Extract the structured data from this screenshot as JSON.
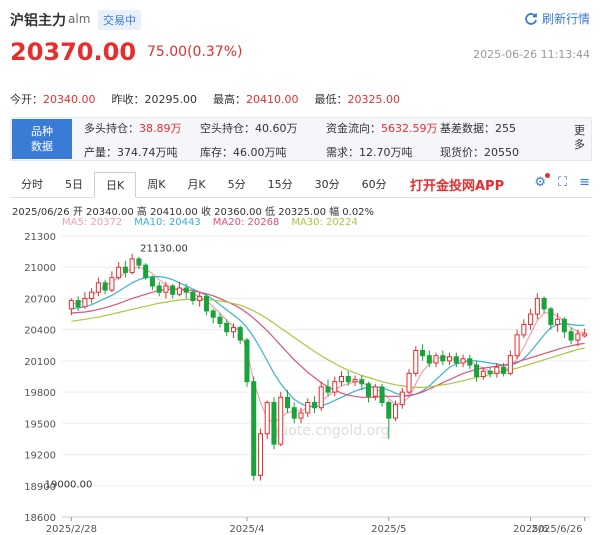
{
  "header": {
    "name": "沪铝主力",
    "code": "alm",
    "status": "交易中",
    "refresh_label": "刷新行情",
    "price": "20370.00",
    "change": "75.00(0.37%)",
    "datetime": "2025-06-26 11:13:44"
  },
  "quote": [
    {
      "label": "今开：",
      "value": "20340.00",
      "color": "red"
    },
    {
      "label": "昨收：",
      "value": "20295.00",
      "color": "black"
    },
    {
      "label": "最高：",
      "value": "20410.00",
      "color": "red"
    },
    {
      "label": "最低：",
      "value": "20325.00",
      "color": "red"
    }
  ],
  "info": {
    "tag_line1": "品种",
    "tag_line2": "数据",
    "more": "更多",
    "items": [
      {
        "label": "多头持仓：",
        "value": "38.89万",
        "color": "red"
      },
      {
        "label": "空头持仓：",
        "value": "40.60万",
        "color": "black"
      },
      {
        "label": "资金流向：",
        "value": "5632.59万",
        "color": "red"
      },
      {
        "label": "基差数据：",
        "value": "255",
        "color": "black"
      },
      {
        "label": "产量：",
        "value": "374.74万吨",
        "color": "black"
      },
      {
        "label": "库存：",
        "value": "46.00万吨",
        "color": "black"
      },
      {
        "label": "需求：",
        "value": "12.70万吨",
        "color": "black"
      },
      {
        "label": "现货价：",
        "value": "20550",
        "color": "black"
      }
    ]
  },
  "tabs": [
    "分时",
    "5日",
    "日K",
    "周K",
    "月K",
    "5分",
    "15分",
    "30分",
    "60分"
  ],
  "active_tab": "日K",
  "app_link": "打开金投网APP",
  "ohlc_line": "2025/06/26  开 20340.00  高 20410.00  收 20360.00  低 20325.00  幅 0.02%",
  "ma": [
    {
      "label": "MA5: 20372",
      "color": "#f2a0b0"
    },
    {
      "label": "MA10: 20443",
      "color": "#3ab0d8"
    },
    {
      "label": "MA20: 20268",
      "color": "#e0507a"
    },
    {
      "label": "MA30: 20224",
      "color": "#a8c840"
    }
  ],
  "watermark": "quote.cngold.org",
  "chart_data": {
    "type": "candlestick",
    "y_ticks": [
      21300,
      21000,
      20700,
      20400,
      20100,
      19800,
      19500,
      19200,
      18900,
      18600
    ],
    "ylim": [
      18600,
      21300
    ],
    "x_ticks": [
      "2025/2/28",
      "2025/4",
      "2025/5",
      "2025/6",
      "2025/6/26"
    ],
    "annotations": [
      {
        "label": "21130.00",
        "value": 21130
      },
      {
        "label": "19000.00",
        "value": 19000
      }
    ],
    "candles": [
      [
        20600,
        20680,
        20540,
        20700
      ],
      [
        20680,
        20620,
        20580,
        20720
      ],
      [
        20620,
        20700,
        20600,
        20760
      ],
      [
        20700,
        20760,
        20650,
        20800
      ],
      [
        20760,
        20850,
        20720,
        20900
      ],
      [
        20850,
        20780,
        20740,
        20880
      ],
      [
        20780,
        20900,
        20760,
        20960
      ],
      [
        20900,
        21000,
        20880,
        21050
      ],
      [
        21000,
        20950,
        20900,
        21060
      ],
      [
        20950,
        21080,
        20930,
        21130
      ],
      [
        21080,
        21020,
        20980,
        21100
      ],
      [
        21020,
        20900,
        20880,
        21040
      ],
      [
        20900,
        20820,
        20780,
        20920
      ],
      [
        20820,
        20760,
        20720,
        20860
      ],
      [
        20760,
        20820,
        20700,
        20860
      ],
      [
        20820,
        20740,
        20700,
        20840
      ],
      [
        20740,
        20800,
        20720,
        20860
      ],
      [
        20800,
        20760,
        20700,
        20840
      ],
      [
        20760,
        20680,
        20640,
        20780
      ],
      [
        20680,
        20720,
        20620,
        20760
      ],
      [
        20720,
        20580,
        20540,
        20740
      ],
      [
        20580,
        20520,
        20460,
        20600
      ],
      [
        20520,
        20460,
        20420,
        20560
      ],
      [
        20460,
        20380,
        20340,
        20500
      ],
      [
        20380,
        20420,
        20320,
        20460
      ],
      [
        20420,
        20300,
        20260,
        20440
      ],
      [
        20300,
        19900,
        19850,
        20320
      ],
      [
        19900,
        19000,
        18950,
        19950
      ],
      [
        19000,
        19400,
        18950,
        19450
      ],
      [
        19400,
        19700,
        19350,
        19720
      ],
      [
        19700,
        19300,
        19250,
        19750
      ],
      [
        19300,
        19750,
        19280,
        19800
      ],
      [
        19750,
        19650,
        19600,
        19820
      ],
      [
        19650,
        19550,
        19500,
        19700
      ],
      [
        19550,
        19600,
        19500,
        19650
      ],
      [
        19600,
        19700,
        19560,
        19740
      ],
      [
        19700,
        19650,
        19600,
        19760
      ],
      [
        19650,
        19850,
        19620,
        19900
      ],
      [
        19850,
        19800,
        19760,
        19920
      ],
      [
        19800,
        19900,
        19760,
        19950
      ],
      [
        19900,
        19950,
        19860,
        20000
      ],
      [
        19950,
        19900,
        19860,
        20000
      ],
      [
        19900,
        19920,
        19860,
        19960
      ],
      [
        19920,
        19880,
        19820,
        19960
      ],
      [
        19880,
        19760,
        19700,
        19900
      ],
      [
        19760,
        19850,
        19720,
        19880
      ],
      [
        19850,
        19700,
        19660,
        19880
      ],
      [
        19700,
        19550,
        19350,
        19720
      ],
      [
        19550,
        19680,
        19520,
        19720
      ],
      [
        19680,
        19800,
        19640,
        19840
      ],
      [
        19800,
        19980,
        19780,
        20020
      ],
      [
        19980,
        20200,
        19950,
        20240
      ],
      [
        20200,
        20150,
        20100,
        20260
      ],
      [
        20150,
        20080,
        20040,
        20200
      ],
      [
        20080,
        20150,
        20040,
        20180
      ],
      [
        20150,
        20100,
        20060,
        20200
      ],
      [
        20100,
        20140,
        20060,
        20180
      ],
      [
        20140,
        20080,
        20040,
        20180
      ],
      [
        20080,
        20120,
        20040,
        20160
      ],
      [
        20120,
        20060,
        20020,
        20160
      ],
      [
        20060,
        19950,
        19900,
        20100
      ],
      [
        19950,
        20000,
        19920,
        20040
      ],
      [
        20000,
        19980,
        19940,
        20040
      ],
      [
        19980,
        20040,
        19940,
        20080
      ],
      [
        20040,
        19980,
        19950,
        20080
      ],
      [
        19980,
        20150,
        19960,
        20200
      ],
      [
        20150,
        20350,
        20120,
        20400
      ],
      [
        20350,
        20450,
        20320,
        20500
      ],
      [
        20450,
        20550,
        20400,
        20600
      ],
      [
        20550,
        20700,
        20500,
        20750
      ],
      [
        20700,
        20600,
        20560,
        20720
      ],
      [
        20600,
        20450,
        20400,
        20620
      ],
      [
        20450,
        20500,
        20380,
        20560
      ],
      [
        20500,
        20380,
        20320,
        20520
      ],
      [
        20380,
        20300,
        20260,
        20420
      ],
      [
        20300,
        20360,
        20240,
        20400
      ],
      [
        20340,
        20360,
        20325,
        20410
      ]
    ],
    "ma_series": {
      "MA5": [
        20640,
        20660,
        20680,
        20720,
        20780,
        20820,
        20860,
        20900,
        20950,
        20990,
        21000,
        20980,
        20940,
        20880,
        20830,
        20790,
        20780,
        20770,
        20740,
        20720,
        20680,
        20620,
        20560,
        20490,
        20430,
        20380,
        20200,
        19900,
        19700,
        19550,
        19500,
        19560,
        19600,
        19620,
        19620,
        19650,
        19680,
        19720,
        19760,
        19820,
        19860,
        19880,
        19900,
        19890,
        19860,
        19830,
        19800,
        19740,
        19680,
        19700,
        19750,
        19880,
        20000,
        20070,
        20120,
        20140,
        20130,
        20110,
        20100,
        20100,
        20060,
        20030,
        20000,
        19990,
        20000,
        20040,
        20120,
        20230,
        20360,
        20490,
        20560,
        20560,
        20530,
        20480,
        20420,
        20380,
        20372
      ],
      "MA10": [
        20600,
        20610,
        20620,
        20640,
        20670,
        20700,
        20730,
        20770,
        20810,
        20850,
        20880,
        20900,
        20910,
        20910,
        20900,
        20880,
        20850,
        20820,
        20790,
        20760,
        20730,
        20690,
        20640,
        20590,
        20540,
        20490,
        20420,
        20330,
        20220,
        20100,
        19980,
        19880,
        19800,
        19730,
        19690,
        19660,
        19660,
        19670,
        19690,
        19720,
        19750,
        19780,
        19810,
        19830,
        19850,
        19850,
        19840,
        19820,
        19790,
        19770,
        19760,
        19780,
        19810,
        19860,
        19920,
        19980,
        20040,
        20070,
        20090,
        20100,
        20100,
        20090,
        20080,
        20070,
        20060,
        20060,
        20080,
        20120,
        20190,
        20270,
        20350,
        20420,
        20450,
        20460,
        20450,
        20440,
        20443
      ],
      "MA20": [
        20560,
        20565,
        20570,
        20580,
        20595,
        20610,
        20630,
        20650,
        20675,
        20700,
        20720,
        20740,
        20760,
        20775,
        20785,
        20790,
        20790,
        20785,
        20775,
        20760,
        20745,
        20725,
        20700,
        20670,
        20640,
        20605,
        20560,
        20510,
        20450,
        20390,
        20320,
        20250,
        20180,
        20110,
        20050,
        19990,
        19940,
        19890,
        19850,
        19820,
        19790,
        19770,
        19760,
        19750,
        19750,
        19750,
        19760,
        19760,
        19760,
        19760,
        19770,
        19780,
        19800,
        19830,
        19860,
        19890,
        19920,
        19950,
        19980,
        20000,
        20020,
        20030,
        20040,
        20050,
        20060,
        20070,
        20090,
        20110,
        20130,
        20150,
        20170,
        20190,
        20210,
        20230,
        20245,
        20258,
        20268
      ],
      "MA30": [
        20480,
        20490,
        20500,
        20510,
        20520,
        20535,
        20550,
        20565,
        20580,
        20595,
        20610,
        20625,
        20640,
        20655,
        20665,
        20675,
        20685,
        20690,
        20695,
        20695,
        20690,
        20685,
        20675,
        20665,
        20650,
        20635,
        20610,
        20580,
        20545,
        20505,
        20460,
        20415,
        20370,
        20325,
        20280,
        20235,
        20190,
        20150,
        20110,
        20075,
        20040,
        20010,
        19985,
        19960,
        19940,
        19920,
        19900,
        19885,
        19870,
        19860,
        19850,
        19845,
        19845,
        19850,
        19860,
        19870,
        19880,
        19895,
        19910,
        19925,
        19940,
        19955,
        19970,
        19985,
        20000,
        20015,
        20030,
        20050,
        20070,
        20090,
        20110,
        20130,
        20150,
        20170,
        20190,
        20210,
        20224
      ]
    }
  }
}
